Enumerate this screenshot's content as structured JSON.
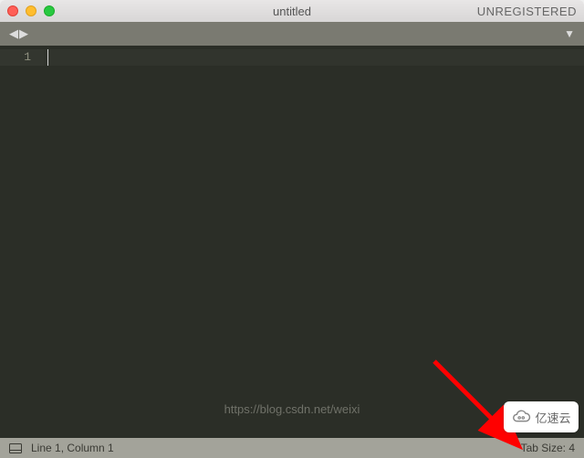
{
  "titlebar": {
    "title": "untitled",
    "unregistered_label": "UNREGISTERED"
  },
  "gutter": {
    "line_numbers": [
      "1"
    ]
  },
  "statusbar": {
    "position_label": "Line 1, Column 1",
    "tab_size_label": "Tab Size: 4"
  },
  "watermark": {
    "url_text": "https://blog.csdn.net/weixi",
    "badge_text": "亿速云"
  }
}
